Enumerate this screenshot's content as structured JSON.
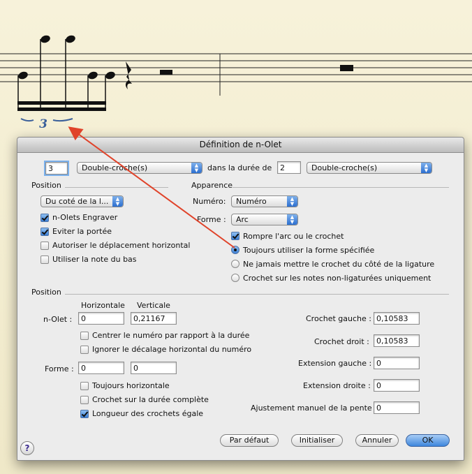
{
  "score": {
    "tuplet_number": "3"
  },
  "dialog": {
    "title": "Définition de n-Olet",
    "top_row": {
      "count_value": "3",
      "unit1": "Double-croche(s)",
      "in_duration_label": "dans la durée de",
      "duration_value": "2",
      "unit2": "Double-croche(s)"
    },
    "position_section": {
      "heading": "Position",
      "placement_popup": "Du coté de la l...",
      "checks": [
        {
          "label": "n-Olets Engraver",
          "checked": true
        },
        {
          "label": "Eviter la portée",
          "checked": true
        },
        {
          "label": "Autoriser le déplacement horizontal",
          "checked": false
        },
        {
          "label": "Utiliser la note du bas",
          "checked": false
        }
      ]
    },
    "appearance_section": {
      "heading": "Apparence",
      "number_label": "Numéro:",
      "number_popup": "Numéro",
      "shape_label": "Forme :",
      "shape_popup": "Arc",
      "break_check": {
        "label": "Rompre l'arc ou le crochet",
        "checked": true
      },
      "radios": [
        {
          "label": "Toujours utiliser la forme spécifiée",
          "selected": true
        },
        {
          "label": "Ne jamais mettre le crochet du côté de la ligature",
          "selected": false
        },
        {
          "label": "Crochet sur les notes non-ligaturées uniquement",
          "selected": false
        }
      ]
    },
    "position2_section": {
      "heading": "Position",
      "col_horizontal": "Horizontale",
      "col_vertical": "Verticale",
      "nolet_label": "n-Olet :",
      "nolet_h": "0",
      "nolet_v": "0,21167",
      "center_check": {
        "label": "Centrer le numéro par rapport à la durée",
        "checked": false
      },
      "ignore_check": {
        "label": "Ignorer le décalage horizontal du numéro",
        "checked": false
      },
      "forme_label": "Forme :",
      "forme_h": "0",
      "forme_v": "0",
      "always_h_check": {
        "label": "Toujours horizontale",
        "checked": false
      },
      "full_duration_check": {
        "label": "Crochet sur la durée complète",
        "checked": false
      },
      "equal_length_check": {
        "label": "Longueur des crochets égale",
        "checked": true
      },
      "left_hook_label": "Crochet gauche :",
      "left_hook_value": "0,10583",
      "right_hook_label": "Crochet droit :",
      "right_hook_value": "0,10583",
      "left_ext_label": "Extension gauche :",
      "left_ext_value": "0",
      "right_ext_label": "Extension droite :",
      "right_ext_value": "0",
      "slope_label": "Ajustement manuel de la pente :",
      "slope_value": "0"
    },
    "buttons": {
      "help": "?",
      "default": "Par défaut",
      "init": "Initialiser",
      "cancel": "Annuler",
      "ok": "OK"
    }
  },
  "colors": {
    "annotation_arrow": "#e0432a",
    "tuplet_number": "#3a5f9a",
    "ok_button": "#3d86dc"
  }
}
